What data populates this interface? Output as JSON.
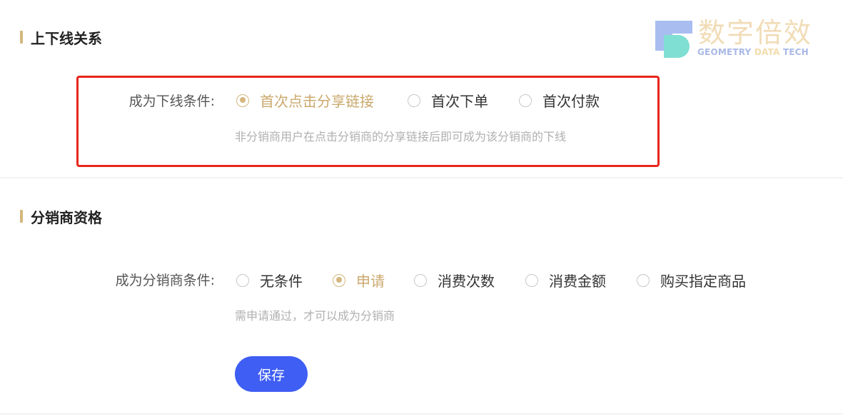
{
  "section1": {
    "title": "上下线关系",
    "condition_label": "成为下线条件:",
    "options": [
      "首次点击分享链接",
      "首次下单",
      "首次付款"
    ],
    "selected_index": 0,
    "hint": "非分销商用户在点击分销商的分享链接后即可成为该分销商的下线"
  },
  "section2": {
    "title": "分销商资格",
    "condition_label": "成为分销商条件:",
    "options": [
      "无条件",
      "申请",
      "消费次数",
      "消费金额",
      "购买指定商品"
    ],
    "selected_index": 1,
    "hint": "需申请通过，才可以成为分销商"
  },
  "save_label": "保存",
  "watermark": {
    "cn": "数字倍效",
    "en_part1": "GEOMETRY ",
    "en_part2": "DATA",
    "en_part3": " TECH"
  },
  "colors": {
    "accent": "#d4b77e",
    "primary": "#3f5ef4",
    "highlight": "#e8261c"
  }
}
